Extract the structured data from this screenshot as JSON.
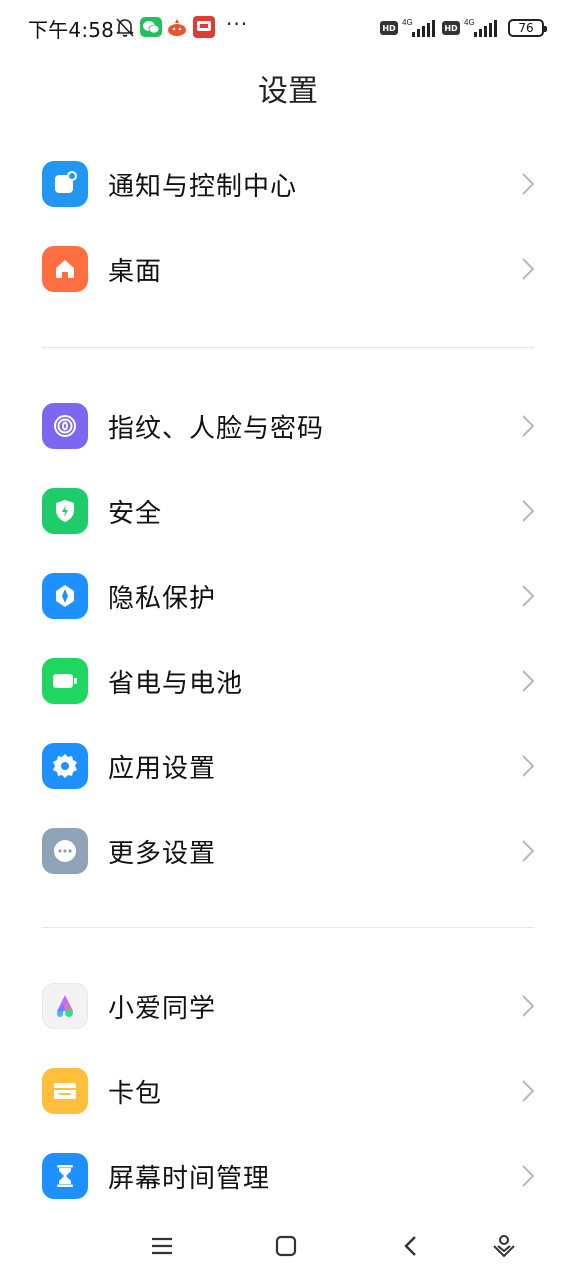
{
  "status_bar": {
    "time": "下午4:58",
    "more": "···",
    "battery": "76",
    "hd_label": "HD",
    "network": "4G"
  },
  "title": "设置",
  "sections": [
    {
      "items": [
        {
          "label": "通知与控制中心",
          "icon": "notification-icon",
          "color": "#2196f3"
        },
        {
          "label": "桌面",
          "icon": "home-icon",
          "color": "#ff6e40"
        }
      ]
    },
    {
      "items": [
        {
          "label": "指纹、人脸与密码",
          "icon": "fingerprint-icon",
          "color": "#7b68ee"
        },
        {
          "label": "安全",
          "icon": "shield-icon",
          "color": "#1fcc6b"
        },
        {
          "label": "隐私保护",
          "icon": "privacy-icon",
          "color": "#1e90ff"
        },
        {
          "label": "省电与电池",
          "icon": "battery-icon",
          "color": "#1ed760"
        },
        {
          "label": "应用设置",
          "icon": "gear-icon",
          "color": "#1e90ff"
        },
        {
          "label": "更多设置",
          "icon": "more-icon",
          "color": "#8fa3b8"
        }
      ]
    },
    {
      "items": [
        {
          "label": "小爱同学",
          "icon": "xiaoai-icon",
          "color": "#f5f5f7"
        },
        {
          "label": "卡包",
          "icon": "wallet-icon",
          "color": "#ffbe3b"
        },
        {
          "label": "屏幕时间管理",
          "icon": "hourglass-icon",
          "color": "#1e90ff"
        }
      ]
    }
  ],
  "nav_bar": {
    "buttons": [
      "menu-icon",
      "home-square-icon",
      "back-icon",
      "assistant-icon"
    ]
  }
}
